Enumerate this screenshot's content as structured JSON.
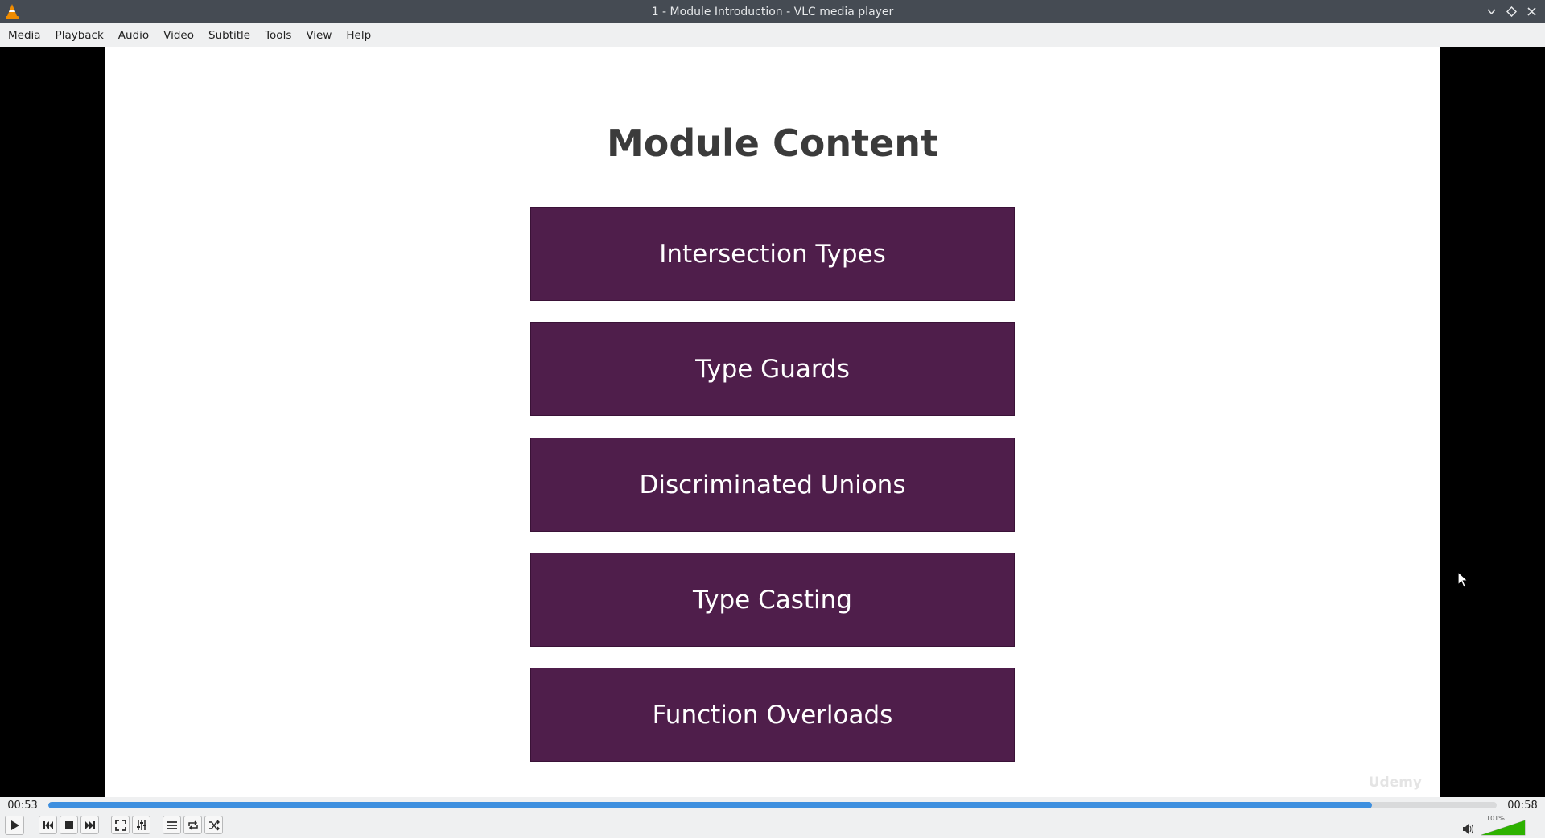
{
  "window": {
    "title": "1 - Module Introduction - VLC media player",
    "app_icon": "vlc-cone-icon"
  },
  "menu": {
    "items": [
      "Media",
      "Playback",
      "Audio",
      "Video",
      "Subtitle",
      "Tools",
      "View",
      "Help"
    ]
  },
  "slide": {
    "title": "Module Content",
    "topics": [
      "Intersection Types",
      "Type Guards",
      "Discriminated Unions",
      "Type Casting",
      "Function Overloads"
    ],
    "watermark": "Udemy",
    "colors": {
      "box": "#4f1e4b",
      "title": "#3b3b3b"
    }
  },
  "playback": {
    "elapsed": "00:53",
    "total": "00:58",
    "progress_fraction": 0.914,
    "volume_label": "101%",
    "volume_fraction": 1.01
  },
  "controls": {
    "icons": [
      "play-icon",
      "previous-icon",
      "stop-icon",
      "next-icon",
      "fullscreen-icon",
      "extended-settings-icon",
      "playlist-icon",
      "loop-icon",
      "shuffle-icon",
      "speaker-icon"
    ]
  },
  "colors": {
    "accent": "#3d8fdf",
    "volume": "#2db200",
    "titlebar": "#454b53"
  }
}
